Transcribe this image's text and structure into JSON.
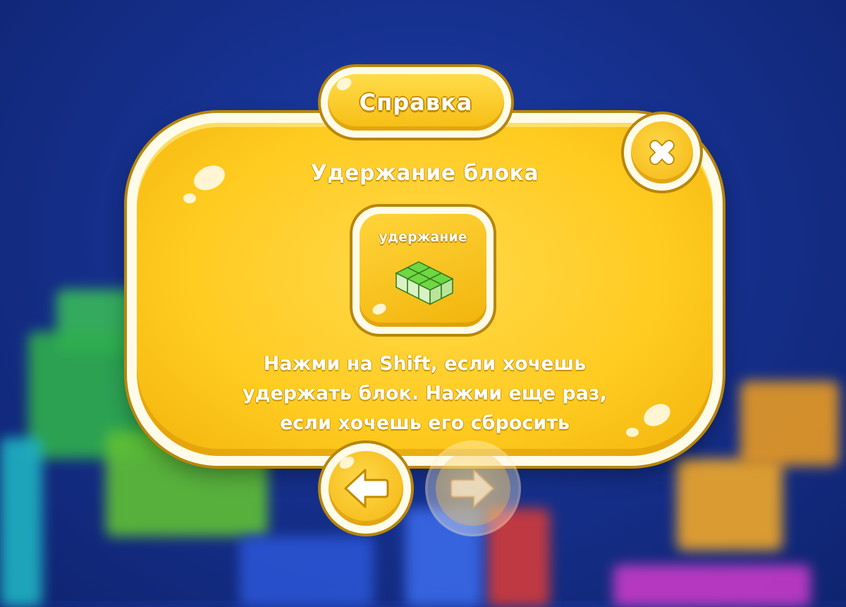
{
  "dialog": {
    "title": "Справка",
    "subtitle": "Удержание блока",
    "feature_card": {
      "label": "удержание",
      "icon": "green-block-icon"
    },
    "description_lines": [
      "Нажми на Shift, если хочешь",
      "удержать блок. Нажми еще раз,",
      "если хочешь его сбросить"
    ]
  },
  "controls": {
    "close_icon": "close-icon",
    "prev_icon": "arrow-left-icon",
    "next_icon": "arrow-right-icon",
    "next_enabled": false
  },
  "colors": {
    "panel_yellow": "#ffcb20",
    "outline": "#b8860b",
    "block_green": "#5cc93a",
    "background_blue": "#16318f"
  }
}
